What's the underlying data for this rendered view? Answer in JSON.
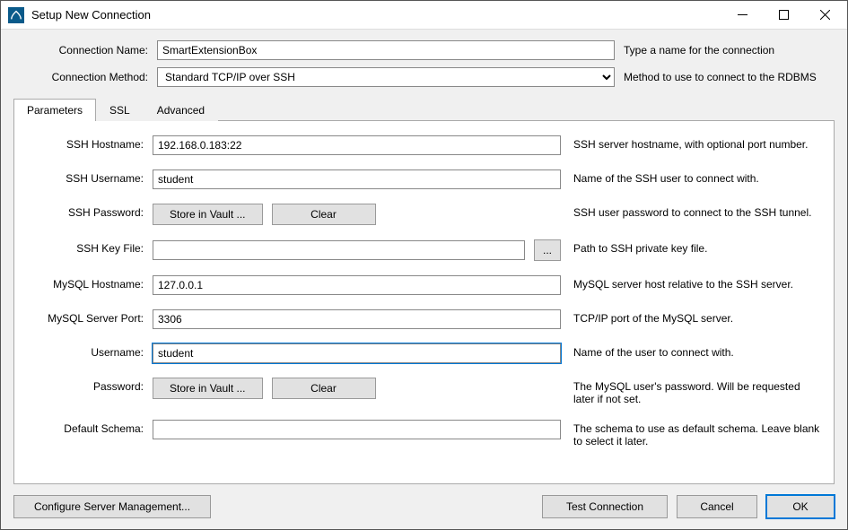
{
  "window": {
    "title": "Setup New Connection"
  },
  "header": {
    "connection_name_label": "Connection Name:",
    "connection_name_value": "SmartExtensionBox",
    "connection_name_hint": "Type a name for the connection",
    "connection_method_label": "Connection Method:",
    "connection_method_value": "Standard TCP/IP over SSH",
    "connection_method_hint": "Method to use to connect to the RDBMS"
  },
  "tabs": {
    "parameters": "Parameters",
    "ssl": "SSL",
    "advanced": "Advanced"
  },
  "params": {
    "ssh_hostname_label": "SSH Hostname:",
    "ssh_hostname_value": "192.168.0.183:22",
    "ssh_hostname_desc": "SSH server hostname, with  optional port number.",
    "ssh_username_label": "SSH Username:",
    "ssh_username_value": "student",
    "ssh_username_desc": "Name of the SSH user to connect with.",
    "ssh_password_label": "SSH Password:",
    "store_in_vault": "Store in Vault ...",
    "clear": "Clear",
    "ssh_password_desc": "SSH user password to connect to the SSH tunnel.",
    "ssh_keyfile_label": "SSH Key File:",
    "ssh_keyfile_value": "",
    "browse": "...",
    "ssh_keyfile_desc": "Path to SSH private key file.",
    "mysql_hostname_label": "MySQL Hostname:",
    "mysql_hostname_value": "127.0.0.1",
    "mysql_hostname_desc": "MySQL server host relative to the SSH server.",
    "mysql_port_label": "MySQL Server Port:",
    "mysql_port_value": "3306",
    "mysql_port_desc": "TCP/IP port of the MySQL server.",
    "username_label": "Username:",
    "username_value": "student",
    "username_desc": "Name of the user to connect with.",
    "password_label": "Password:",
    "password_desc": "The MySQL user's password. Will be requested later if not set.",
    "default_schema_label": "Default Schema:",
    "default_schema_value": "",
    "default_schema_desc": "The schema to use as default schema. Leave blank to select it later."
  },
  "footer": {
    "configure": "Configure Server Management...",
    "test": "Test Connection",
    "cancel": "Cancel",
    "ok": "OK"
  }
}
